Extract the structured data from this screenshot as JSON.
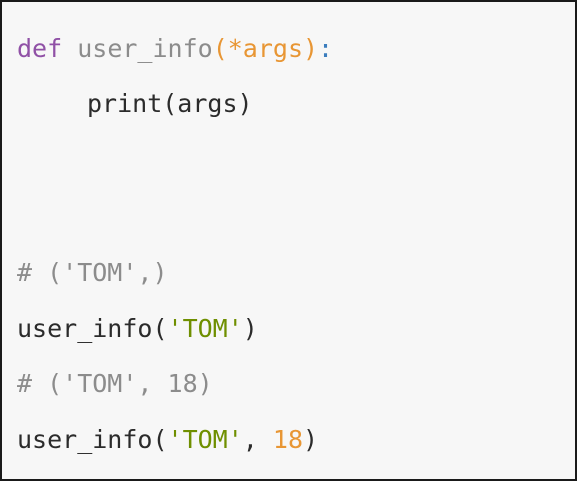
{
  "code": {
    "line1": {
      "keyword": "def",
      "name": "user_info",
      "params": "(*args)",
      "colon": ":"
    },
    "line2": {
      "text": "print(args)"
    },
    "line3": {
      "comment": "# ('TOM',)"
    },
    "line4": {
      "call": "user_info(",
      "string": "'TOM'",
      "close": ")"
    },
    "line5": {
      "comment": "# ('TOM', 18)"
    },
    "line6": {
      "call": "user_info(",
      "string": "'TOM'",
      "sep": ", ",
      "number": "18",
      "close": ")"
    }
  },
  "colors": {
    "keyword": "#9051a6",
    "function_def": "#8c8c8c",
    "parameter": "#e89634",
    "colon": "#3b7dbd",
    "string": "#6f8f00",
    "number": "#e89634",
    "comment": "#8c8c8c",
    "text": "#2b2b2b",
    "background": "#f7f7f7",
    "border": "#1a1a1a"
  }
}
